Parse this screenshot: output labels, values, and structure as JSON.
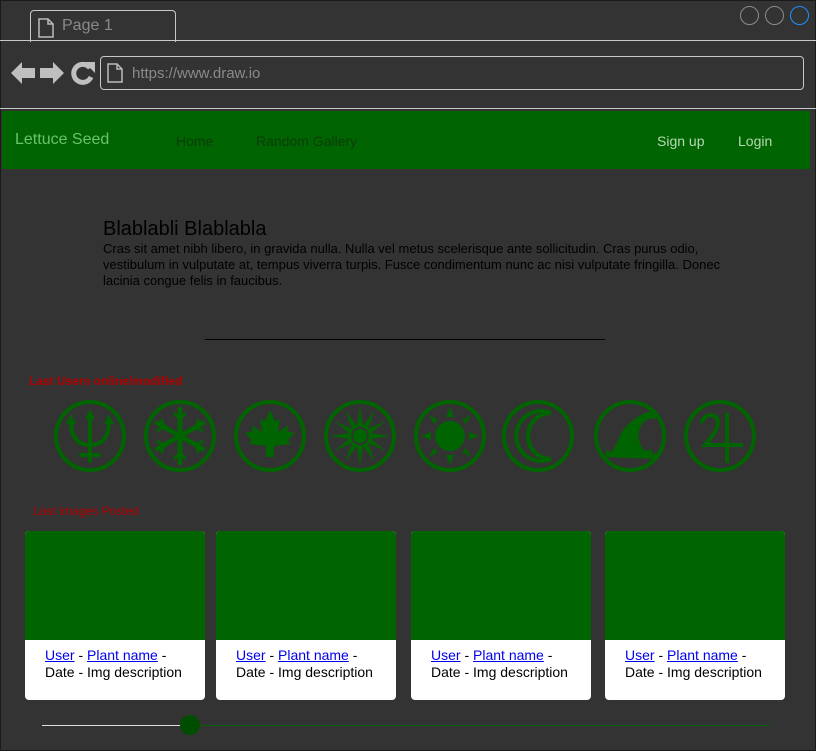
{
  "browser": {
    "tab_title": "Page 1",
    "url_placeholder": "https://www.draw.io"
  },
  "navbar": {
    "brand": "Lettuce Seed",
    "links": [
      "Home",
      "Random Gallery"
    ],
    "signup": "Sign up",
    "login": "Login"
  },
  "hero": {
    "title": "Blablabli Blablabla",
    "text": "Cras sit amet nibh libero, in gravida nulla. Nulla vel metus scelerisque ante sollicitudin. Cras purus odio, vestibulum in vulputate at, tempus viverra turpis. Fusce condimentum nunc ac nisi vulputate fringilla. Donec lacinia congue felis in faucibus."
  },
  "users_section": {
    "label": "Last Users online/modified",
    "icons": [
      "trident-icon",
      "snowflake-icon",
      "maple-leaf-icon",
      "starburst-icon",
      "sun-icon",
      "crescent-moon-icon",
      "wave-icon",
      "jupiter-symbol-icon"
    ]
  },
  "images_section": {
    "label": "Last Images Posted",
    "cards": [
      {
        "user": "User",
        "sep1": " - ",
        "plant": "Plant name",
        "sep2": " -",
        "desc": "Date - Img description"
      },
      {
        "user": "User",
        "sep1": " - ",
        "plant": "Plant name",
        "sep2": " -",
        "desc": "Date - Img description"
      },
      {
        "user": "User",
        "sep1": " - ",
        "plant": "Plant name",
        "sep2": " -",
        "desc": "Date - Img description"
      },
      {
        "user": "User",
        "sep1": " - ",
        "plant": "Plant name",
        "sep2": " -",
        "desc": "Date - Img description"
      }
    ]
  },
  "slider": {
    "value_fraction": 0.2
  },
  "colors": {
    "background": "#333333",
    "navbar": "#006400",
    "brand_text": "#6cc16c",
    "icon_green": "#006400",
    "section_label": "#b20000",
    "link": "#0000ee"
  }
}
